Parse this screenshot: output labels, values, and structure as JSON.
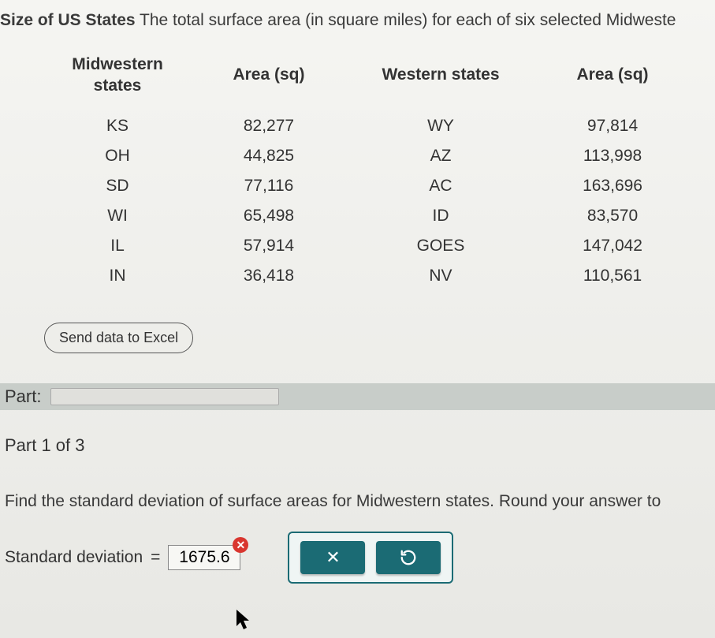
{
  "header": {
    "title_bold": "Size of US States",
    "title_rest": " The total surface area (in square miles) for each of six selected Midweste"
  },
  "table": {
    "headers": {
      "col1_line1": "Midwestern",
      "col1_line2": "states",
      "col2": "Area (sq)",
      "col3": "Western states",
      "col4": "Area (sq)"
    },
    "rows": [
      {
        "mw_state": "KS",
        "mw_area": "82,277",
        "w_state": "WY",
        "w_area": "97,814"
      },
      {
        "mw_state": "OH",
        "mw_area": "44,825",
        "w_state": "AZ",
        "w_area": "113,998"
      },
      {
        "mw_state": "SD",
        "mw_area": "77,116",
        "w_state": "AC",
        "w_area": "163,696"
      },
      {
        "mw_state": "WI",
        "mw_area": "65,498",
        "w_state": "ID",
        "w_area": "83,570"
      },
      {
        "mw_state": "IL",
        "mw_area": "57,914",
        "w_state": "GOES",
        "w_area": "147,042"
      },
      {
        "mw_state": "IN",
        "mw_area": "36,418",
        "w_state": "NV",
        "w_area": "110,561"
      }
    ]
  },
  "buttons": {
    "send_excel": "Send data to Excel"
  },
  "part_bar": {
    "label": "Part:"
  },
  "part_label": "Part 1 of 3",
  "question": "Find the standard deviation of surface areas for Midwestern states. Round your answer to",
  "answer": {
    "label_prefix": "Standard deviation",
    "equals": "=",
    "value": "1675.6"
  },
  "icons": {
    "error_badge": "✕",
    "clear": "✕",
    "reset": "↺"
  }
}
